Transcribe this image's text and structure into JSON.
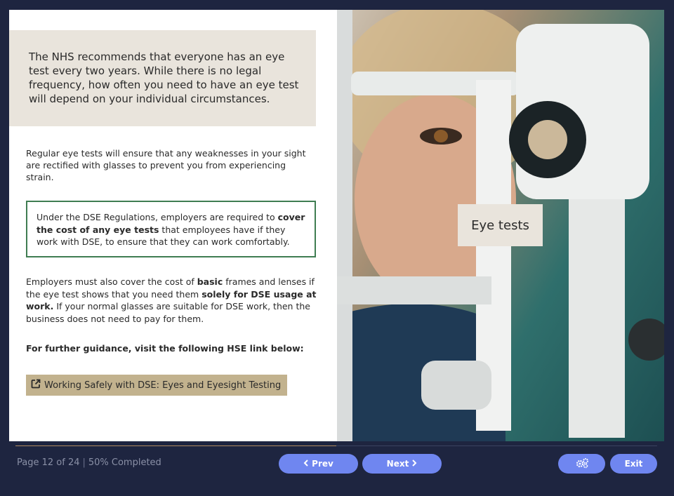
{
  "slide": {
    "intro": "The NHS recommends that everyone has an eye test every two years. While there is no legal frequency, how often you need to have an eye test will depend on your individual circumstances.",
    "para1": "Regular eye tests will ensure that any weaknesses in your sight are rectified with glasses to prevent you from experiencing strain.",
    "dse_box": {
      "part1": "Under the DSE Regulations, employers are required to ",
      "bold": "cover the cost of any eye tests",
      "part2": " that employees have if they work with DSE, to ensure that they can work comfortably."
    },
    "para2": {
      "part1": "Employers must also cover the cost of ",
      "bold1": "basic",
      "part2": " frames and lenses if the eye test shows that you need them ",
      "bold2": "solely for DSE usage at work.",
      "part3": " If your normal glasses are suitable for DSE work, then the business does not need to pay for them."
    },
    "guidance": "For further guidance, visit the following HSE link below:",
    "link_label": "Working Safely with DSE: Eyes and Eyesight Testing",
    "link_icon": "external-link-icon",
    "image_label": "Eye tests"
  },
  "footer": {
    "page_text": "Page 12 of 24",
    "separator": "|",
    "completed_text": "50% Completed",
    "progress": 0.5,
    "prev_label": "Prev",
    "next_label": "Next",
    "settings_icon": "gears-icon",
    "exit_label": "Exit"
  },
  "colors": {
    "background": "#1e2540",
    "accent_button": "#6f86f0",
    "beige_panel": "#e9e4dc",
    "green_border": "#3f7d52",
    "link_button": "#c2b28e",
    "progress_fill": "#b08a60"
  }
}
